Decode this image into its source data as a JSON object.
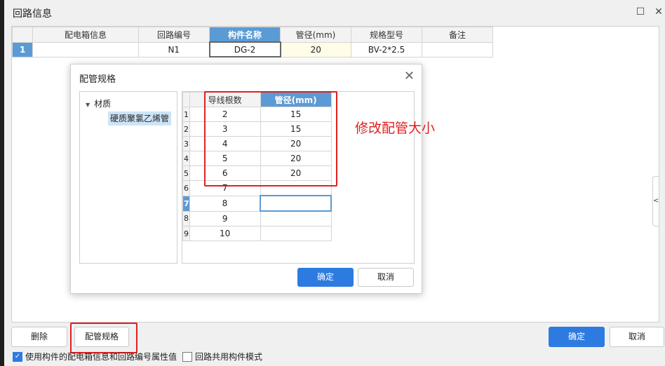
{
  "window": {
    "title": "回路信息",
    "maximize_icon": "square-icon",
    "close_icon": "x-icon"
  },
  "main_table": {
    "columns": [
      "配电箱信息",
      "回路编号",
      "构件名称",
      "管径(mm)",
      "规格型号",
      "备注"
    ],
    "selected_column": "构件名称",
    "rows": [
      {
        "num": "1",
        "cells": [
          "",
          "N1",
          "DG-2",
          "20",
          "BV-2*2.5",
          ""
        ]
      }
    ]
  },
  "side_tab": {
    "label": "<"
  },
  "dialog": {
    "title": "配管规格",
    "tree": {
      "root": "材质",
      "child": "硬质聚氯乙烯管"
    },
    "columns": [
      "导线根数",
      "管径(mm)"
    ],
    "rows": [
      {
        "num": "1",
        "count": "2",
        "diameter": "15"
      },
      {
        "num": "2",
        "count": "3",
        "diameter": "15"
      },
      {
        "num": "3",
        "count": "4",
        "diameter": "20"
      },
      {
        "num": "4",
        "count": "5",
        "diameter": "20"
      },
      {
        "num": "5",
        "count": "6",
        "diameter": "20"
      },
      {
        "num": "6",
        "count": "7",
        "diameter": ""
      },
      {
        "num": "7",
        "count": "8",
        "diameter": ""
      },
      {
        "num": "8",
        "count": "9",
        "diameter": ""
      },
      {
        "num": "9",
        "count": "10",
        "diameter": ""
      }
    ],
    "confirm": "确定",
    "cancel": "取消"
  },
  "annotation": "修改配管大小",
  "bottom": {
    "delete": "删除",
    "pipe_spec": "配管规格",
    "confirm": "确定",
    "cancel": "取消",
    "checkbox1": "使用构件的配电箱信息和回路编号属性值",
    "checkbox1_checked": true,
    "checkbox2": "回路共用构件模式",
    "checkbox2_checked": false
  },
  "colors": {
    "accent": "#2d7be0",
    "header_selected": "#5b9bd5",
    "annotation": "#e02020"
  }
}
